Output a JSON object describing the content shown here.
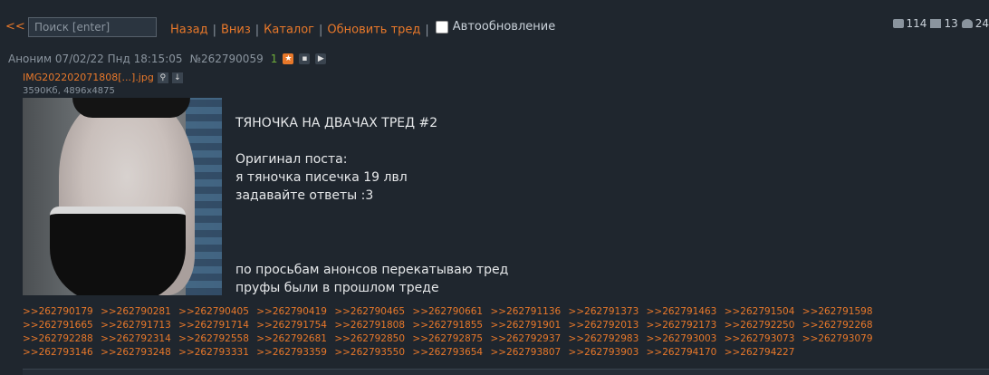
{
  "topbar": {
    "back_label": "<<",
    "search_placeholder": "Поиск [enter]",
    "nav": [
      "Назад",
      "Вниз",
      "Каталог",
      "Обновить тред"
    ],
    "separator": "|",
    "autoupdate_label": "Автообновление",
    "stats": {
      "posts": "114",
      "images": "13",
      "users": "24"
    }
  },
  "post": {
    "author": "Аноним",
    "date": "07/02/22 Пнд 18:15:05",
    "number": "№262790059",
    "counter": "1",
    "file_name": "IMG202202071808[...].jpg",
    "file_info": "3590Кб, 4896x4875",
    "text": {
      "title": "ТЯНОЧКА НА ДВАЧАХ ТРЕД #2",
      "line1": "Оригинал поста:",
      "line2": "я тяночка писечка 19 лвл",
      "line3": "задавайте ответы :3",
      "line4": "по просьбам анонсов перекатываю тред",
      "line5": "пруфы были в прошлом треде"
    },
    "replies": [
      ">>262790179",
      ">>262790281",
      ">>262790405",
      ">>262790419",
      ">>262790465",
      ">>262790661",
      ">>262791136",
      ">>262791373",
      ">>262791463",
      ">>262791504",
      ">>262791598",
      ">>262791665",
      ">>262791713",
      ">>262791714",
      ">>262791754",
      ">>262791808",
      ">>262791855",
      ">>262791901",
      ">>262792013",
      ">>262792173",
      ">>262792250",
      ">>262792268",
      ">>262792288",
      ">>262792314",
      ">>262792558",
      ">>262792681",
      ">>262792850",
      ">>262792875",
      ">>262792937",
      ">>262792983",
      ">>262793003",
      ">>262793073",
      ">>262793079",
      ">>262793146",
      ">>262793248",
      ">>262793331",
      ">>262793359",
      ">>262793550",
      ">>262793654",
      ">>262793807",
      ">>262793903",
      ">>262794170",
      ">>262794227"
    ]
  }
}
